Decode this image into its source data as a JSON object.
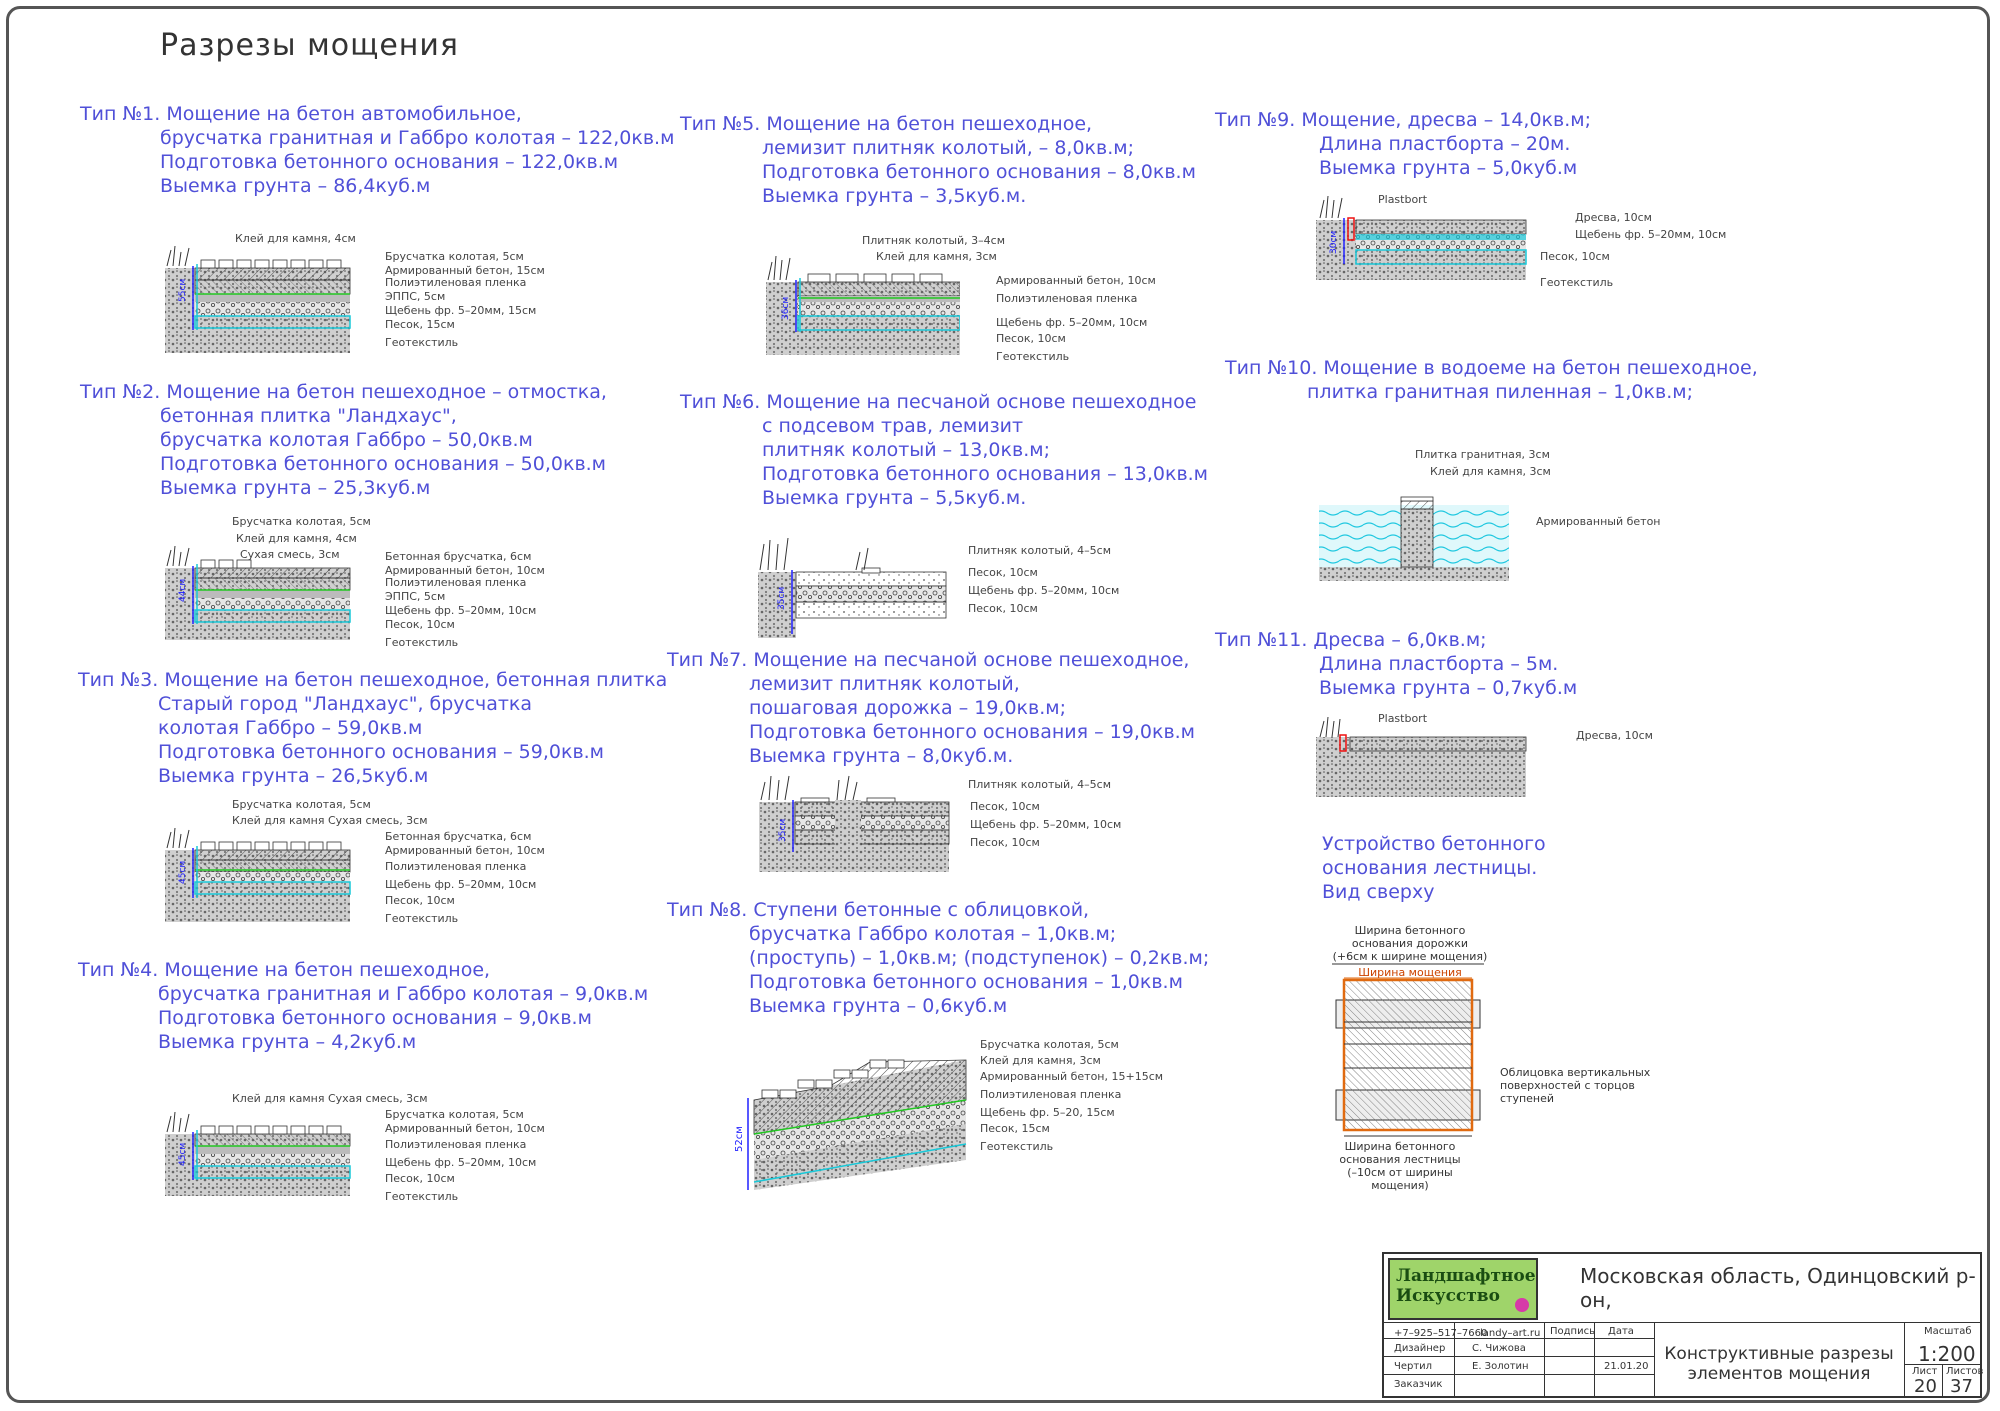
{
  "page_title": "Разрезы мощения",
  "types": [
    {
      "id": "t1",
      "lines": [
        "Тип №1. Мощение на бетон автомобильное,",
        "брусчатка гранитная и Габбро колотая – 122,0кв.м",
        "Подготовка бетонного основания – 122,0кв.м",
        "Выемка грунта – 86,4куб.м"
      ]
    },
    {
      "id": "t2",
      "lines": [
        "Тип №2. Мощение на бетон пешеходное – отмостка,",
        "бетонная плитка \"Ландхаус\",",
        "брусчатка колотая Габбро – 50,0кв.м",
        "Подготовка бетонного основания – 50,0кв.м",
        "Выемка грунта – 25,3куб.м"
      ]
    },
    {
      "id": "t3",
      "lines": [
        "Тип №3. Мощение на бетон пешеходное, бетонная плитка",
        "Старый город \"Ландхаус\", брусчатка",
        "колотая Габбро – 59,0кв.м",
        "Подготовка бетонного основания – 59,0кв.м",
        "Выемка грунта – 26,5куб.м"
      ]
    },
    {
      "id": "t4",
      "lines": [
        "Тип №4. Мощение на бетон пешеходное,",
        "брусчатка гранитная и Габбро колотая – 9,0кв.м",
        "Подготовка бетонного основания – 9,0кв.м",
        "Выемка грунта – 4,2куб.м"
      ]
    },
    {
      "id": "t5",
      "lines": [
        "Тип №5. Мощение на бетон пешеходное,",
        "лемизит плитняк колотый,   – 8,0кв.м;",
        "Подготовка бетонного основания – 8,0кв.м",
        "Выемка грунта – 3,5куб.м."
      ]
    },
    {
      "id": "t6",
      "lines": [
        "Тип №6. Мощение на песчаной основе пешеходное",
        "с подсевом трав, лемизит",
        "плитняк колотый – 13,0кв.м;",
        "Подготовка бетонного основания – 13,0кв.м",
        "Выемка грунта – 5,5куб.м."
      ]
    },
    {
      "id": "t7",
      "lines": [
        "Тип №7. Мощение на песчаной основе пешеходное,",
        "лемизит плитняк колотый,",
        "пошаговая дорожка  – 19,0кв.м;",
        "Подготовка бетонного основания – 19,0кв.м",
        "Выемка грунта – 8,0куб.м."
      ]
    },
    {
      "id": "t8",
      "lines": [
        "Тип №8. Ступени бетонные с облицовкой,",
        "брусчатка Габбро колотая – 1,0кв.м;",
        "(проступь) – 1,0кв.м; (подступенок) – 0,2кв.м;",
        "Подготовка бетонного основания – 1,0кв.м",
        "Выемка грунта – 0,6куб.м"
      ]
    },
    {
      "id": "t9",
      "lines": [
        "Тип №9.  Мощение, дресва – 14,0кв.м;",
        "Длина пластборта – 20м.",
        "Выемка грунта – 5,0куб.м"
      ]
    },
    {
      "id": "t10",
      "lines": [
        "Тип №10. Мощение в водоеме на бетон пешеходное,",
        "плитка гранитная пиленная – 1,0кв.м;"
      ]
    },
    {
      "id": "t11",
      "lines": [
        "Тип №11.  Дресва – 6,0кв.м;",
        "Длина пластборта – 5м.",
        "Выемка грунта – 0,7куб.м"
      ]
    },
    {
      "id": "stairs",
      "lines": [
        "Устройство бетонного",
        "основания лестницы.",
        "Вид сверху"
      ]
    }
  ],
  "labels": {
    "s1": [
      "Клей для камня, 4см",
      "Брусчатка колотая, 5см",
      "Армированный бетон, 15см",
      "Полиэтиленовая пленка",
      "ЭППС, 5см",
      "Щебень фр. 5–20мм, 15см",
      "Песок, 15см",
      "Геотекстиль"
    ],
    "s1_dim": "55см",
    "s2": [
      "Брусчатка колотая, 5см",
      "Клей для камня, 4см",
      "Сухая смесь, 3см",
      "Бетонная брусчатка, 6см",
      "Армированный бетон, 10см",
      "Полиэтиленовая пленка",
      "ЭППС, 5см",
      "Щебень фр. 5–20мм, 10см",
      "Песок, 10см",
      "Геотекстиль"
    ],
    "s2_dim": "44см",
    "s3": [
      "Брусчатка колотая, 5см",
      "Клей для камня Сухая смесь, 3см",
      "Бетонная брусчатка, 6см",
      "Армированный бетон, 10см",
      "Полиэтиленовая пленка",
      "Щебень фр. 5–20мм, 10см",
      "Песок, 10см",
      "Геотекстиль"
    ],
    "s3_dim": "45см",
    "s4": [
      "Клей для камня Сухая смесь, 3см",
      "Брусчатка колотая, 5см",
      "Армированный бетон, 10см",
      "Полиэтиленовая пленка",
      "Щебень фр. 5–20мм, 10см",
      "Песок, 10см",
      "Геотекстиль"
    ],
    "s4_dim": "45см",
    "s5": [
      "Плитняк колотый, 3–4см",
      "Клей для камня, 3см",
      "Армированный бетон, 10см",
      "Полиэтиленовая пленка",
      "Щебень фр. 5–20мм, 10см",
      "Песок, 10см",
      "Геотекстиль"
    ],
    "s5_dim": "36см",
    "s6": [
      "Плитняк колотый, 4–5см",
      "Песок, 10см",
      "Щебень фр. 5–20мм, 10см",
      "Песок, 10см"
    ],
    "s6_dim": "35см",
    "s7": [
      "Плитняк колотый, 4–5см",
      "Песок, 10см",
      "Щебень фр. 5–20мм, 10см",
      "Песок, 10см"
    ],
    "s7_dim": "35см",
    "s8": [
      "Брусчатка колотая, 5см",
      "Клей для камня, 3см",
      "Армированный бетон, 15+15см",
      "Полиэтиленовая пленка",
      "Щебень фр. 5–20, 15см",
      "Песок, 15см",
      "Геотекстиль"
    ],
    "s8_dim": "52см",
    "s9": [
      "Plastbort",
      "Дресва, 10см",
      "Щебень фр. 5–20мм, 10см",
      "Песок, 10см",
      "Геотекстиль"
    ],
    "s9_dim": "30см",
    "s10": [
      "Плитка гранитная, 3см",
      "Клей для камня, 3см",
      "Армированный бетон"
    ],
    "s11": [
      "Plastbort",
      "Дресва, 10см"
    ],
    "plan": [
      "Ширина бетонного",
      "основания дорожки",
      "(+6см к ширине мощения)",
      "Ширина мощения",
      "Облицовка вертикальных",
      "поверхностей с торцов",
      "ступеней",
      "Ширина бетонного",
      "основания лестницы",
      "(–10см от ширины",
      "мощения)"
    ]
  },
  "title_block": {
    "logo_line1": "Ландшафтное",
    "logo_line2": "Искусство",
    "address": "Московская область, Одинцовский р-он,",
    "phone": "+7–925–517–7660",
    "site": "landy–art.ru",
    "podpis": "Подпись",
    "data": "Дата",
    "r1_label": "Дизайнер",
    "r1_name": "С. Чижова",
    "r2_label": "Чертил",
    "r2_name": "Е. Золотин",
    "r2_date": "21.01.20",
    "r3_label": "Заказчик",
    "name_line1": "Конструктивные разрезы",
    "name_line2": "элементов мощения",
    "scale_h": "Масштаб",
    "scale": "1:200",
    "list_h": "Лист",
    "lists_h": "Листов",
    "list": "20",
    "lists": "37"
  },
  "colors": {
    "text_blue": "#5050d8",
    "cyan": "#19c8d8",
    "green": "#22c722",
    "blue_dim": "#2020ff",
    "logo_green": "#9fd46a",
    "logo_dot": "#d63aa8",
    "orange": "#e06a10"
  }
}
